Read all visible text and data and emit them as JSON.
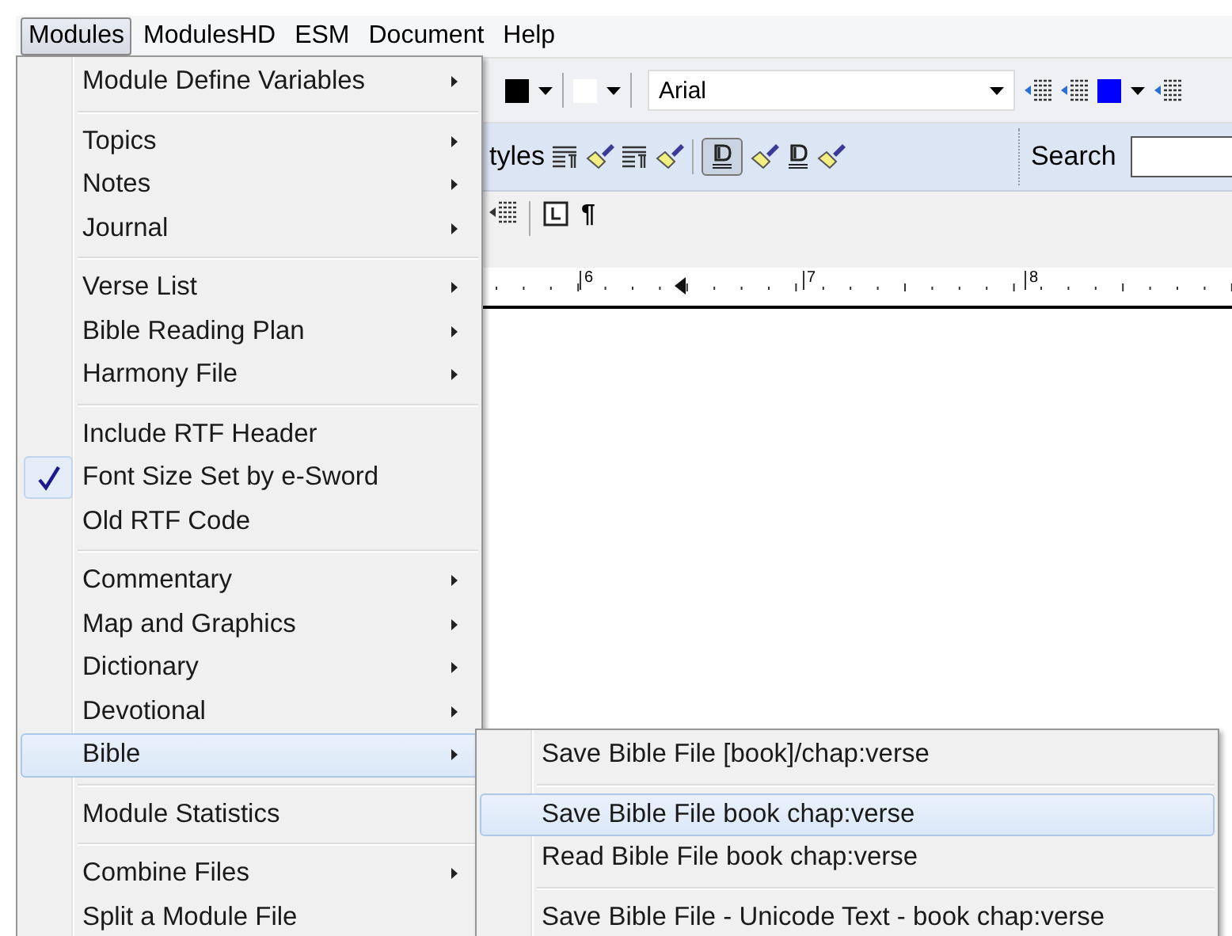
{
  "menubar": [
    {
      "label": "Modules",
      "selected": true
    },
    {
      "label": "ModulesHD",
      "selected": false
    },
    {
      "label": "ESM",
      "selected": false
    },
    {
      "label": "Document",
      "selected": false
    },
    {
      "label": "Help",
      "selected": false
    }
  ],
  "toolbar": {
    "font_field": {
      "value": "Arial"
    },
    "styles_label": "tyles",
    "search_label": "Search",
    "pilcrow": "¶",
    "styles_pressed": true
  },
  "ruler": {
    "marks": [
      "6",
      "7",
      "8"
    ]
  },
  "menu": {
    "groups": [
      [
        {
          "label": "Module Define Variables",
          "submenu": true,
          "checked": false,
          "selected": false
        }
      ],
      [
        {
          "label": "Topics",
          "submenu": true,
          "checked": false,
          "selected": false
        },
        {
          "label": "Notes",
          "submenu": true,
          "checked": false,
          "selected": false
        },
        {
          "label": "Journal",
          "submenu": true,
          "checked": false,
          "selected": false
        }
      ],
      [
        {
          "label": "Verse List",
          "submenu": true,
          "checked": false,
          "selected": false
        },
        {
          "label": "Bible Reading Plan",
          "submenu": true,
          "checked": false,
          "selected": false
        },
        {
          "label": "Harmony File",
          "submenu": true,
          "checked": false,
          "selected": false
        }
      ],
      [
        {
          "label": "Include RTF Header",
          "submenu": false,
          "checked": false,
          "selected": false
        },
        {
          "label": "Font Size Set by e-Sword",
          "submenu": false,
          "checked": true,
          "selected": false
        },
        {
          "label": "Old RTF Code",
          "submenu": false,
          "checked": false,
          "selected": false
        }
      ],
      [
        {
          "label": "Commentary",
          "submenu": true,
          "checked": false,
          "selected": false
        },
        {
          "label": "Map and Graphics",
          "submenu": true,
          "checked": false,
          "selected": false
        },
        {
          "label": "Dictionary",
          "submenu": true,
          "checked": false,
          "selected": false
        },
        {
          "label": "Devotional",
          "submenu": true,
          "checked": false,
          "selected": false
        },
        {
          "label": "Bible",
          "submenu": true,
          "checked": false,
          "selected": true
        }
      ],
      [
        {
          "label": "Module Statistics",
          "submenu": false,
          "checked": false,
          "selected": false
        }
      ],
      [
        {
          "label": "Combine Files",
          "submenu": true,
          "checked": false,
          "selected": false
        },
        {
          "label": "Split a Module File",
          "submenu": false,
          "checked": false,
          "selected": false
        }
      ]
    ]
  },
  "submenu": {
    "groups": [
      [
        {
          "label": "Save Bible File [book]/chap:verse",
          "submenu": false,
          "checked": false,
          "selected": false
        }
      ],
      [
        {
          "label": "Save Bible File  book chap:verse",
          "submenu": false,
          "checked": false,
          "selected": true
        },
        {
          "label": "Read Bible File  book chap:verse",
          "submenu": false,
          "checked": false,
          "selected": false
        }
      ],
      [
        {
          "label": "Save Bible File - Unicode Text - book chap:verse",
          "submenu": false,
          "checked": false,
          "selected": false
        }
      ]
    ]
  }
}
